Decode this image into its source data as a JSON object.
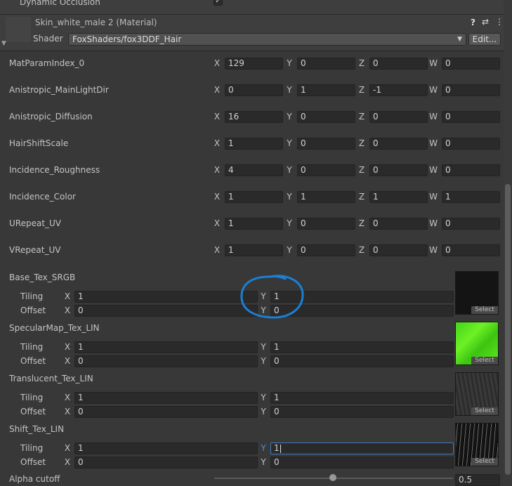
{
  "top_row": {
    "label": "Dynamic Occlusion",
    "checked": "✓"
  },
  "material": {
    "name": "Skin_white_male 2 (Material)",
    "shader_label": "Shader",
    "shader_value": "FoxShaders/fox3DDF_Hair",
    "edit_label": "Edit...",
    "help_icon": "?",
    "settings_icon": "⇄",
    "menu_icon": "⋮"
  },
  "vectors": [
    {
      "label": "MatParamIndex_0",
      "x": "129",
      "y": "0",
      "z": "0",
      "w": "0"
    },
    {
      "label": "Anistropic_MainLightDir",
      "x": "0",
      "y": "1",
      "z": "-1",
      "w": "0"
    },
    {
      "label": "Anistropic_Diffusion",
      "x": "16",
      "y": "0",
      "z": "0",
      "w": "0"
    },
    {
      "label": "HairShiftScale",
      "x": "1",
      "y": "0",
      "z": "0",
      "w": "0"
    },
    {
      "label": "Incidence_Roughness",
      "x": "4",
      "y": "0",
      "z": "0",
      "w": "0"
    },
    {
      "label": "Incidence_Color",
      "x": "1",
      "y": "1",
      "z": "1",
      "w": "1"
    },
    {
      "label": "URepeat_UV",
      "x": "1",
      "y": "0",
      "z": "0",
      "w": "0"
    },
    {
      "label": "VRepeat_UV",
      "x": "1",
      "y": "0",
      "z": "0",
      "w": "0"
    }
  ],
  "axes": {
    "x": "X",
    "y": "Y",
    "z": "Z",
    "w": "W"
  },
  "textures": [
    {
      "label": "Base_Tex_SRGB",
      "tiling_x": "1",
      "tiling_y": "1",
      "offset_x": "0",
      "offset_y": "0"
    },
    {
      "label": "SpecularMap_Tex_LIN",
      "tiling_x": "1",
      "tiling_y": "1",
      "offset_x": "0",
      "offset_y": "0"
    },
    {
      "label": "Translucent_Tex_LIN",
      "tiling_x": "1",
      "tiling_y": "1",
      "offset_x": "0",
      "offset_y": "0"
    },
    {
      "label": "Shift_Tex_LIN",
      "tiling_x": "1",
      "tiling_y": "1",
      "offset_x": "0",
      "offset_y": "0"
    }
  ],
  "tiling_label": "Tiling",
  "offset_label": "Offset",
  "select_label": "Select",
  "bottom_row": {
    "label": "Alpha cutoff",
    "value": "0.5"
  },
  "colors": {
    "panel": "#383838",
    "field": "#2a2a2a",
    "accent": "#3a79bb",
    "annotation": "#1a7fd6",
    "spec_green": "#5ee018"
  }
}
